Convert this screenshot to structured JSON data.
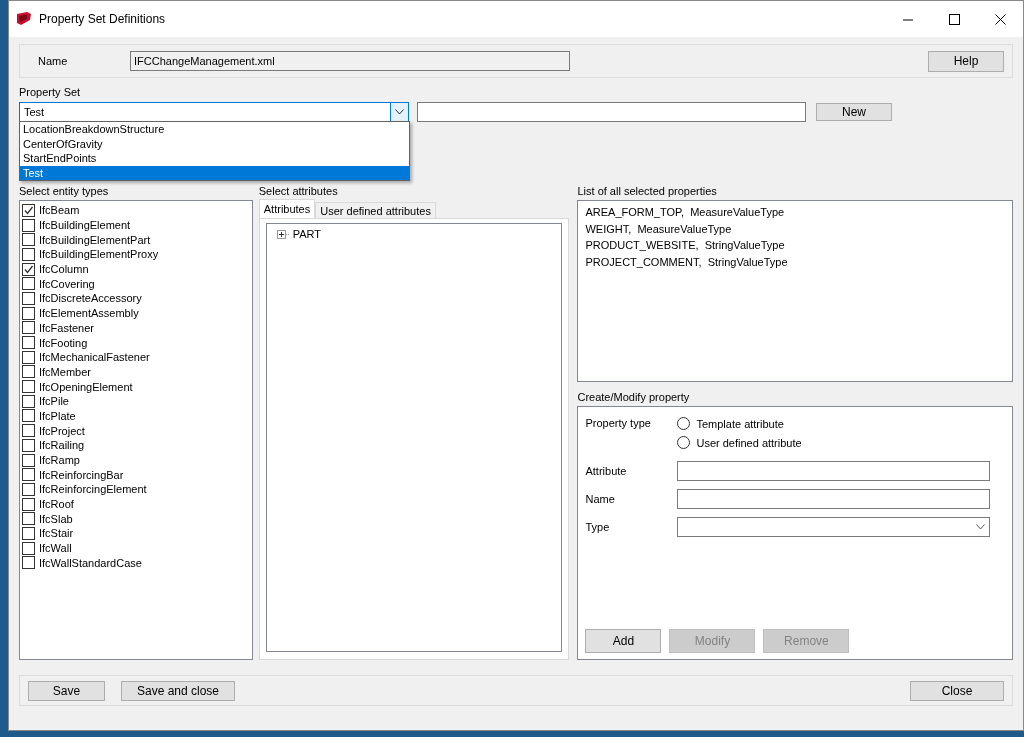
{
  "window": {
    "title": "Property Set Definitions"
  },
  "name_row": {
    "label": "Name",
    "value": "IFCChangeManagement.xml",
    "help_button": "Help"
  },
  "property_set": {
    "label": "Property Set",
    "combo_value": "Test",
    "new_button": "New",
    "dropdown_options": [
      {
        "label": "LocationBreakdownStructure",
        "selected": false
      },
      {
        "label": "CenterOfGravity",
        "selected": false
      },
      {
        "label": "StartEndPoints",
        "selected": false
      },
      {
        "label": "Test",
        "selected": true
      }
    ]
  },
  "entity_types": {
    "label": "Select entity types",
    "items": [
      {
        "label": "IfcBeam",
        "checked": true
      },
      {
        "label": "IfcBuildingElement",
        "checked": false
      },
      {
        "label": "IfcBuildingElementPart",
        "checked": false
      },
      {
        "label": "IfcBuildingElementProxy",
        "checked": false
      },
      {
        "label": "IfcColumn",
        "checked": true
      },
      {
        "label": "IfcCovering",
        "checked": false
      },
      {
        "label": "IfcDiscreteAccessory",
        "checked": false
      },
      {
        "label": "IfcElementAssembly",
        "checked": false
      },
      {
        "label": "IfcFastener",
        "checked": false
      },
      {
        "label": "IfcFooting",
        "checked": false
      },
      {
        "label": "IfcMechanicalFastener",
        "checked": false
      },
      {
        "label": "IfcMember",
        "checked": false
      },
      {
        "label": "IfcOpeningElement",
        "checked": false
      },
      {
        "label": "IfcPile",
        "checked": false
      },
      {
        "label": "IfcPlate",
        "checked": false
      },
      {
        "label": "IfcProject",
        "checked": false
      },
      {
        "label": "IfcRailing",
        "checked": false
      },
      {
        "label": "IfcRamp",
        "checked": false
      },
      {
        "label": "IfcReinforcingBar",
        "checked": false
      },
      {
        "label": "IfcReinforcingElement",
        "checked": false
      },
      {
        "label": "IfcRoof",
        "checked": false
      },
      {
        "label": "IfcSlab",
        "checked": false
      },
      {
        "label": "IfcStair",
        "checked": false
      },
      {
        "label": "IfcWall",
        "checked": false
      },
      {
        "label": "IfcWallStandardCase",
        "checked": false
      }
    ]
  },
  "attributes": {
    "label": "Select attributes",
    "tabs": [
      {
        "label": "Attributes",
        "selected": true
      },
      {
        "label": "User defined attributes",
        "selected": false
      }
    ],
    "tree": [
      {
        "label": "PART",
        "expanded": false
      }
    ]
  },
  "selected_properties": {
    "label": "List of all selected properties",
    "items": [
      "AREA_FORM_TOP,  MeasureValueType",
      "WEIGHT,  MeasureValueType",
      "PRODUCT_WEBSITE,  StringValueType",
      "PROJECT_COMMENT,  StringValueType"
    ]
  },
  "create_modify": {
    "label": "Create/Modify property",
    "property_type_label": "Property type",
    "property_type_options": [
      {
        "label": "Template attribute",
        "selected": false
      },
      {
        "label": "User defined attribute",
        "selected": false
      }
    ],
    "fields": [
      {
        "label": "Attribute",
        "kind": "text"
      },
      {
        "label": "Name",
        "kind": "text"
      },
      {
        "label": "Type",
        "kind": "dropdown"
      }
    ],
    "buttons": [
      {
        "label": "Add",
        "disabled": false
      },
      {
        "label": "Modify",
        "disabled": true
      },
      {
        "label": "Remove",
        "disabled": true
      }
    ]
  },
  "footer": {
    "left_buttons": [
      "Save",
      "Save and close"
    ],
    "right_buttons": [
      "Close"
    ]
  }
}
